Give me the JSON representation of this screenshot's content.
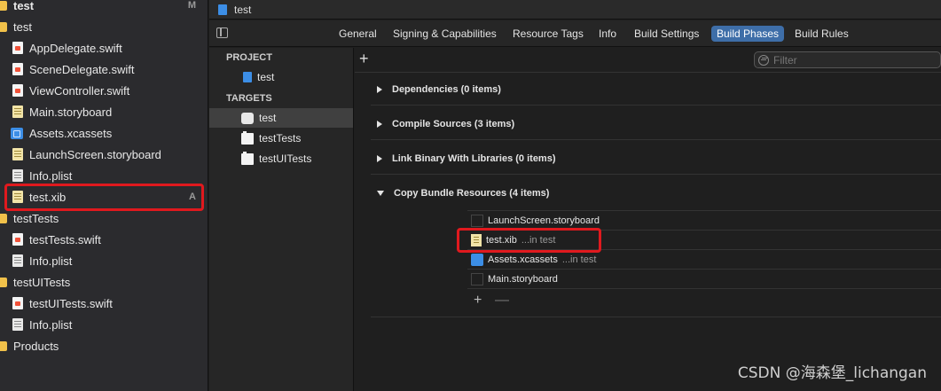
{
  "navigator": {
    "items": [
      {
        "label": "test",
        "icon": "folder-icon",
        "badge": "M"
      },
      {
        "label": "AppDelegate.swift",
        "icon": "swift-file-icon",
        "badge": ""
      },
      {
        "label": "SceneDelegate.swift",
        "icon": "swift-file-icon",
        "badge": ""
      },
      {
        "label": "ViewController.swift",
        "icon": "swift-file-icon",
        "badge": ""
      },
      {
        "label": "Main.storyboard",
        "icon": "storyboard-file-icon",
        "badge": ""
      },
      {
        "label": "Assets.xcassets",
        "icon": "assets-icon",
        "badge": ""
      },
      {
        "label": "LaunchScreen.storyboard",
        "icon": "storyboard-file-icon",
        "badge": ""
      },
      {
        "label": "Info.plist",
        "icon": "plist-file-icon",
        "badge": ""
      },
      {
        "label": "test.xib",
        "icon": "xib-file-icon",
        "badge": "A"
      },
      {
        "label": "testTests",
        "icon": "folder-icon",
        "badge": ""
      },
      {
        "label": "testTests.swift",
        "icon": "swift-file-icon",
        "badge": ""
      },
      {
        "label": "Info.plist",
        "icon": "plist-file-icon",
        "badge": ""
      },
      {
        "label": "testUITests",
        "icon": "folder-icon",
        "badge": ""
      },
      {
        "label": "testUITests.swift",
        "icon": "swift-file-icon",
        "badge": ""
      },
      {
        "label": "Info.plist",
        "icon": "plist-file-icon",
        "badge": ""
      },
      {
        "label": "Products",
        "icon": "folder-icon",
        "badge": ""
      }
    ]
  },
  "breadcrumb": {
    "project": "test"
  },
  "tabs": [
    "General",
    "Signing & Capabilities",
    "Resource Tags",
    "Info",
    "Build Settings",
    "Build Phases",
    "Build Rules"
  ],
  "active_tab": "Build Phases",
  "targets_panel": {
    "project_header": "PROJECT",
    "project": "test",
    "targets_header": "TARGETS",
    "targets": [
      "test",
      "testTests",
      "testUITests"
    ]
  },
  "filter": {
    "placeholder": "Filter"
  },
  "build_phases": [
    {
      "label": "Dependencies (0 items)",
      "expanded": false
    },
    {
      "label": "Compile Sources (3 items)",
      "expanded": false
    },
    {
      "label": "Link Binary With Libraries (0 items)",
      "expanded": false
    },
    {
      "label": "Copy Bundle Resources (4 items)",
      "expanded": true
    }
  ],
  "resources": [
    {
      "name": "LaunchScreen.storyboard",
      "location": ""
    },
    {
      "name": "test.xib",
      "location": "...in test"
    },
    {
      "name": "Assets.xcassets",
      "location": "...in test"
    },
    {
      "name": "Main.storyboard",
      "location": ""
    }
  ],
  "resource_controls": {
    "add": "+",
    "remove": "—"
  },
  "watermark": "CSDN @海森堡_lichangan",
  "colors": {
    "accent": "#3e6ea8",
    "highlight": "#e0191e",
    "folder": "#f1c14a"
  }
}
